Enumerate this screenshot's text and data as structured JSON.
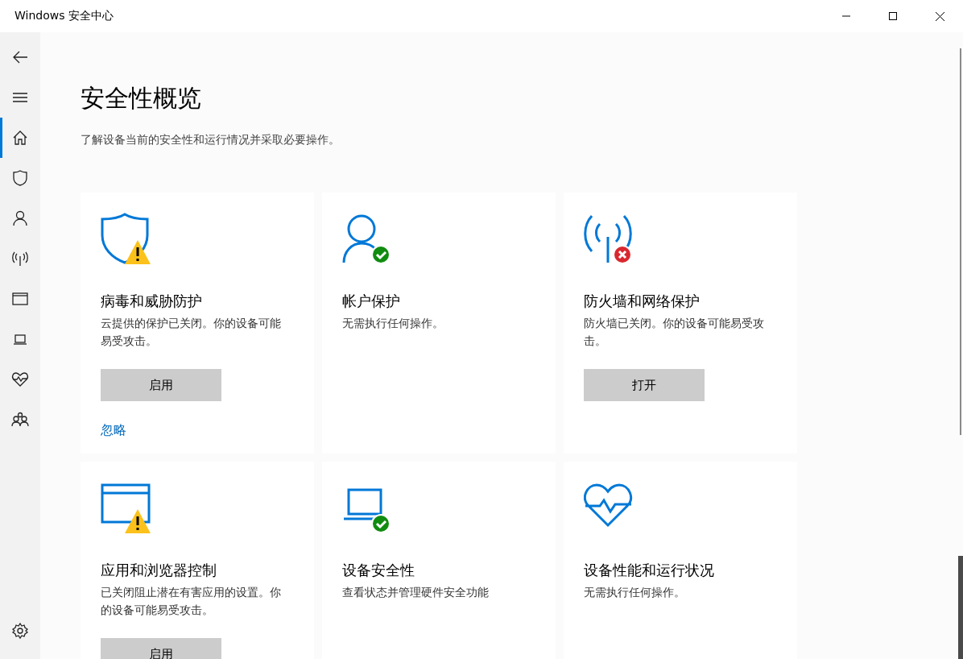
{
  "window": {
    "title": "Windows 安全中心"
  },
  "sidebar": {
    "items": [
      {
        "kind": "back",
        "selected": false
      },
      {
        "kind": "menu",
        "selected": false
      },
      {
        "kind": "home",
        "selected": true
      },
      {
        "kind": "shield",
        "selected": false
      },
      {
        "kind": "person",
        "selected": false
      },
      {
        "kind": "antenna",
        "selected": false
      },
      {
        "kind": "window",
        "selected": false
      },
      {
        "kind": "laptop",
        "selected": false
      },
      {
        "kind": "heart",
        "selected": false
      },
      {
        "kind": "family",
        "selected": false
      }
    ],
    "bottom_item": {
      "kind": "settings",
      "selected": false
    }
  },
  "page": {
    "title": "安全性概览",
    "subtitle": "了解设备当前的安全性和运行情况并采取必要操作。"
  },
  "cards": [
    {
      "kind": "shield",
      "badge": {
        "kind": "warning"
      },
      "title": "病毒和威胁防护",
      "description": "云提供的保护已关闭。你的设备可能易受攻击。",
      "button": "启用",
      "link": "忽略"
    },
    {
      "kind": "person",
      "badge": {
        "kind": "check"
      },
      "title": "帐户保护",
      "description": "无需执行任何操作。"
    },
    {
      "kind": "antenna",
      "badge": {
        "kind": "error"
      },
      "title": "防火墙和网络保护",
      "description": "防火墙已关闭。你的设备可能易受攻击。",
      "button": "打开"
    },
    {
      "kind": "window",
      "badge": {
        "kind": "warning"
      },
      "title": "应用和浏览器控制",
      "description": "已关闭阻止潜在有害应用的设置。你的设备可能易受攻击。",
      "button": "启用"
    },
    {
      "kind": "laptop",
      "badge": {
        "kind": "check"
      },
      "title": "设备安全性",
      "description": "查看状态并管理硬件安全功能"
    },
    {
      "kind": "heart",
      "title": "设备性能和运行状况",
      "description": "无需执行任何操作。"
    }
  ]
}
